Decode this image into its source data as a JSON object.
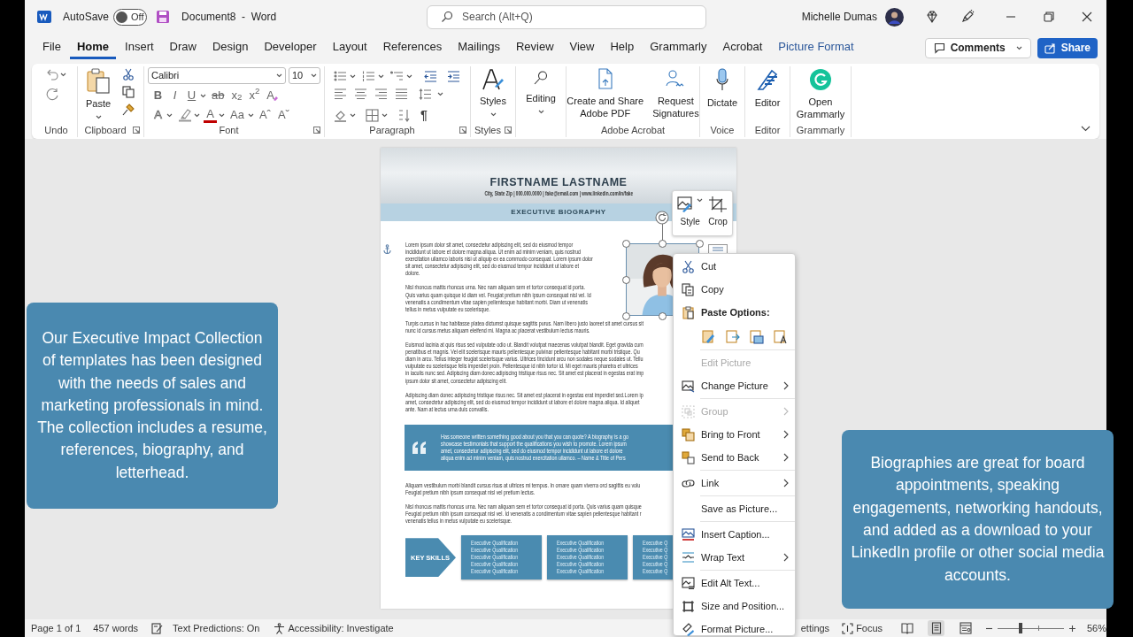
{
  "title_bar": {
    "autosave": {
      "label": "AutoSave",
      "state": "Off",
      "on": false
    },
    "document_title": "Document8  -  Word",
    "search": {
      "placeholder": "Search (Alt+Q)"
    },
    "user_name": "Michelle Dumas"
  },
  "tabs": [
    {
      "label": "File",
      "selected": false,
      "contextual": false
    },
    {
      "label": "Home",
      "selected": true,
      "contextual": false
    },
    {
      "label": "Insert",
      "selected": false,
      "contextual": false
    },
    {
      "label": "Draw",
      "selected": false,
      "contextual": false
    },
    {
      "label": "Design",
      "selected": false,
      "contextual": false
    },
    {
      "label": "Developer",
      "selected": false,
      "contextual": false
    },
    {
      "label": "Layout",
      "selected": false,
      "contextual": false
    },
    {
      "label": "References",
      "selected": false,
      "contextual": false
    },
    {
      "label": "Mailings",
      "selected": false,
      "contextual": false
    },
    {
      "label": "Review",
      "selected": false,
      "contextual": false
    },
    {
      "label": "View",
      "selected": false,
      "contextual": false
    },
    {
      "label": "Help",
      "selected": false,
      "contextual": false
    },
    {
      "label": "Grammarly",
      "selected": false,
      "contextual": false
    },
    {
      "label": "Acrobat",
      "selected": false,
      "contextual": false
    },
    {
      "label": "Picture Format",
      "selected": false,
      "contextual": true
    }
  ],
  "comments_button": "Comments",
  "share_button": "Share",
  "ribbon": {
    "undo": {
      "label": "Undo"
    },
    "clipboard": {
      "label": "Clipboard",
      "paste": "Paste"
    },
    "font": {
      "label": "Font",
      "family": "Calibri",
      "size": "10",
      "row_2": [
        {
          "kind": "bold",
          "text": "B"
        },
        {
          "kind": "italic",
          "text": "I"
        },
        {
          "kind": "underline",
          "text": "U"
        },
        {
          "kind": "strike",
          "text": "ab"
        },
        {
          "kind": "subscript",
          "text": "x$_{2}$"
        },
        {
          "kind": "superscript",
          "text": "x$^{2}$"
        },
        {
          "kind": "clear",
          "text": "A"
        }
      ],
      "row_3": [
        {
          "kind": "effects",
          "text": "A"
        },
        {
          "kind": "highlight"
        },
        {
          "kind": "color",
          "text": "A"
        },
        {
          "kind": "case",
          "text": "Aa"
        },
        {
          "kind": "grow",
          "text": "Aˆ"
        },
        {
          "kind": "shrink",
          "text": "Aˇ"
        }
      ]
    },
    "paragraph": {
      "label": "Paragraph",
      "marks_button": "¶"
    },
    "styles": {
      "label": "Styles",
      "button": "Styles"
    },
    "editing": {
      "button": "Editing"
    },
    "adobe_acrobat": {
      "label": "Adobe Acrobat",
      "buttons": [
        [
          "Create and Share",
          "Adobe PDF"
        ],
        [
          "Request",
          "Signatures"
        ]
      ]
    },
    "voice": {
      "label": "Voice",
      "button": "Dictate"
    },
    "editor": {
      "label": "Editor",
      "button": "Editor"
    },
    "grammarly": {
      "label": "Grammarly",
      "button": [
        "Open",
        "Grammarly"
      ]
    }
  },
  "document": {
    "name": "FIRSTNAME LASTNAME",
    "contact": "City, State Zip | 000.000.0000 | fake@email.com | www.linkedin.com/in/fake",
    "section_title": "EXECUTIVE BIOGRAPHY",
    "paragraphs_before_quote": [
      [
        "Lorem ipsum dolor sit amet, consectetur adipiscing elit, sed do eiusmod tempor",
        "incididunt ut labore et dolore magna aliqua. Ut enim ad minim veniam, quis nostrud",
        "exercitation ullamco laboris nisi ut aliquip ex ea commodo consequat. Lorem ipsum dolor",
        "sit amet, consectetur adipiscing elit, sed do eiusmod tempor incididunt ut labore et",
        "dolore."
      ],
      [
        "Nisl rhoncus mattis rhoncus urna. Nec nam aliquam sem et tortor consequat id porta.",
        "Quis varius quam quisque id diam vel. Feugiat pretium nibh ipsum consequat nisl vel. Id",
        "venenatis a condimentum vitae sapien pellentesque habitant morbi. Diam ut venenatis",
        "tellus in metus vulputate eu scelerisque."
      ],
      [
        "Turpis cursus in hac habitasse platea dictumst quisque sagittis purus. Nam libero justo laoreet sit amet cursus sit",
        "nunc id cursus metus aliquam eleifend mi. Magna ac placerat vestibulum lectus mauris."
      ],
      [
        "Euismod lacinia at quis risus sed vulputate odio ut. Blandit volutpat maecenas volutpat blandit. Eget gravida cum",
        "penatibus et magnis. Vel elit scelerisque mauris pellentesque pulvinar pellentesque habitant morbi tristique. Qu",
        "diam in arcu. Tellus integer feugiat scelerisque varius. Ultrices tincidunt arcu non sodales neque sodales ut. Tellu",
        "vulputate eu scelerisque felis imperdiet proin. Pellentesque id nibh tortor id. Mi eget mauris pharetra et ultrices",
        "in iaculis nunc sed. Adipiscing diam donec adipiscing tristique risus nec. Sit amet est placerat in egestas erat imp",
        "ipsum dolor sit amet, consectetur adipiscing elit."
      ],
      [
        "Adipiscing diam donec adipiscing tristique risus nec. Sit amet est placerat in egestas erat imperdiet sed.Lorem ip",
        "amet, consectetur adipiscing elit, sed do eiusmod tempor incididunt ut labore et dolore magna aliqua. Id aliquet",
        "ante. Nam at lectus urna duis convallis."
      ]
    ],
    "quote": [
      "Has someone written something good about you that you can quote? A biography is a go",
      "showcase testimonials that support the qualifications you wish to promote. Lorem ipsum",
      "amet, consectetur adipiscing elit, sed do eiusmod tempor incididunt ut labore et dolore",
      "aliqua enim ad minim veniam, quis nostrud exercitation ullamco.  – Name & Title of Pers"
    ],
    "paragraphs_after_quote": [
      [
        "Aliquam vestibulum morbi blandit cursus risus at ultrices mi tempus. In ornare quam viverra orci sagittis eu volu",
        "Feugiat pretium nibh ipsum consequat nisl vel pretium lectus."
      ],
      [
        "Nisl rhoncus mattis rhoncus urna. Nec nam aliquam sem et tortor consequat id porta. Quis varius quam quisque",
        "Feugiat pretium nibh ipsum consequat nisl vel. Id venenatis a condimentum vitae sapien pellentesque habitant r",
        "venenatis tellus in metus vulputate eu scelerisque."
      ]
    ],
    "key_skills": {
      "label": "KEY SKILLS",
      "boxes": [
        [
          "Executive Qualification",
          "Executive Qualification",
          "Executive Qualification",
          "Executive Qualification",
          "Executive Qualification"
        ],
        [
          "Executive Qualification",
          "Executive Qualification",
          "Executive Qualification",
          "Executive Qualification",
          "Executive Qualification"
        ],
        [
          "Executive Q",
          "Executive Q",
          "Executive Q",
          "Executive Q",
          "Executive Q"
        ]
      ]
    }
  },
  "mini_toolbar": [
    "Style",
    "Crop"
  ],
  "context_menu": [
    {
      "kind": "item",
      "label": "Cut",
      "disabled": false,
      "submenu": false
    },
    {
      "kind": "item",
      "label": "Copy",
      "disabled": false,
      "submenu": false
    },
    {
      "kind": "header",
      "label": "Paste Options:"
    },
    {
      "kind": "paste_options"
    },
    {
      "kind": "separator"
    },
    {
      "kind": "item",
      "label": "Edit Picture",
      "disabled": true,
      "submenu": false
    },
    {
      "kind": "item",
      "label": "Change Picture",
      "disabled": false,
      "submenu": true
    },
    {
      "kind": "separator"
    },
    {
      "kind": "item",
      "label": "Group",
      "disabled": true,
      "submenu": true
    },
    {
      "kind": "item",
      "label": "Bring to Front",
      "disabled": false,
      "submenu": true
    },
    {
      "kind": "item",
      "label": "Send to Back",
      "disabled": false,
      "submenu": true
    },
    {
      "kind": "separator"
    },
    {
      "kind": "item",
      "label": "Link",
      "disabled": false,
      "submenu": true
    },
    {
      "kind": "separator"
    },
    {
      "kind": "item",
      "label": "Save as Picture...",
      "disabled": false,
      "submenu": false
    },
    {
      "kind": "separator"
    },
    {
      "kind": "item",
      "label": "Insert Caption...",
      "disabled": false,
      "submenu": false
    },
    {
      "kind": "item",
      "label": "Wrap Text",
      "disabled": false,
      "submenu": true
    },
    {
      "kind": "separator"
    },
    {
      "kind": "item",
      "label": "Edit Alt Text...",
      "disabled": false,
      "submenu": false
    },
    {
      "kind": "item",
      "label": "Size and Position...",
      "disabled": false,
      "submenu": false
    },
    {
      "kind": "item",
      "label": "Format Picture...",
      "disabled": false,
      "submenu": false
    }
  ],
  "callouts": [
    "Our Executive Impact Collection of templates has been designed with the needs of sales and marketing professionals in mind. The collection includes a resume, references, biography, and letterhead.",
    "Biographies are great for board appointments, speaking engagements, networking handouts, and added as a download to your LinkedIn profile or other social media accounts."
  ],
  "status_bar": {
    "page": "Page 1 of 1",
    "words": "457 words",
    "text_predictions": "Text Predictions: On",
    "accessibility": "Accessibility: Investigate",
    "display_settings": "ettings",
    "focus": "Focus",
    "views": [
      {
        "selected": false
      },
      {
        "selected": true
      },
      {
        "selected": false
      }
    ],
    "zoom": {
      "percent": "56%"
    }
  }
}
